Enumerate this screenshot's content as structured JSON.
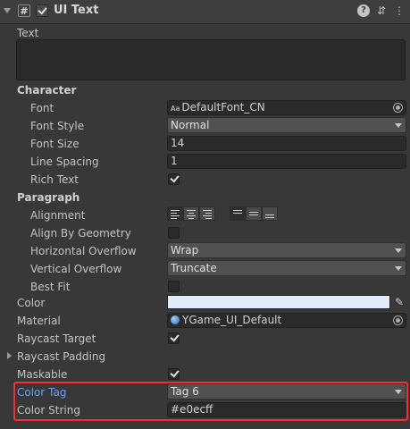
{
  "component": {
    "title": "UI Text",
    "enabled": true,
    "script_icon": "#"
  },
  "text_section": {
    "label": "Text",
    "value": ""
  },
  "character": {
    "header": "Character",
    "font": {
      "label": "Font",
      "value": "DefaultFont_CN",
      "icon": "Aa"
    },
    "font_style": {
      "label": "Font Style",
      "value": "Normal"
    },
    "font_size": {
      "label": "Font Size",
      "value": "14"
    },
    "line_spacing": {
      "label": "Line Spacing",
      "value": "1"
    },
    "rich_text": {
      "label": "Rich Text",
      "checked": true
    }
  },
  "paragraph": {
    "header": "Paragraph",
    "alignment": {
      "label": "Alignment",
      "horizontal_selected": "left",
      "vertical_selected": "top"
    },
    "align_by_geometry": {
      "label": "Align By Geometry",
      "checked": false
    },
    "horizontal_overflow": {
      "label": "Horizontal Overflow",
      "value": "Wrap"
    },
    "vertical_overflow": {
      "label": "Vertical Overflow",
      "value": "Truncate"
    },
    "best_fit": {
      "label": "Best Fit",
      "checked": false
    }
  },
  "color": {
    "label": "Color",
    "value": "#e0ecff"
  },
  "material": {
    "label": "Material",
    "value": "YGame_UI_Default"
  },
  "raycast_target": {
    "label": "Raycast Target",
    "checked": true
  },
  "raycast_padding": {
    "label": "Raycast Padding"
  },
  "maskable": {
    "label": "Maskable",
    "checked": true
  },
  "color_tag": {
    "label": "Color Tag",
    "value": "Tag 6"
  },
  "color_string": {
    "label": "Color String",
    "value": "#e0ecff"
  },
  "colors": {
    "highlight": "#ff2a2a",
    "accent_label": "#6f9ff0"
  }
}
